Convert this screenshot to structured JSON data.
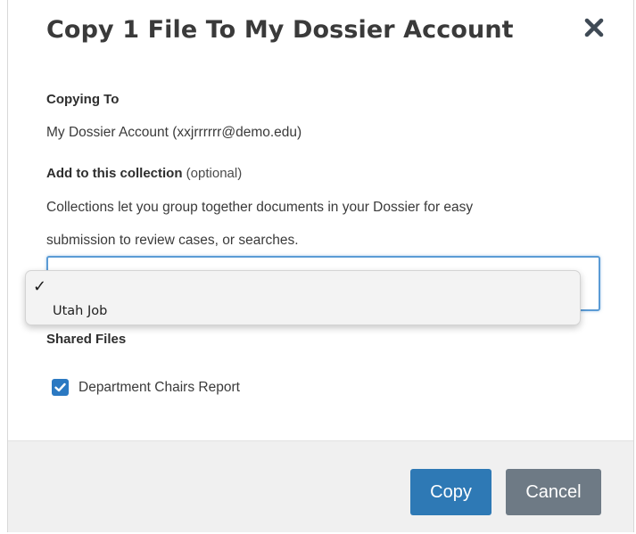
{
  "modal": {
    "title": "Copy 1 File To My Dossier Account",
    "close_icon": "close-x-icon"
  },
  "copying_to": {
    "label": "Copying To",
    "value": "My Dossier Account (xxjrrrrrr@demo.edu)"
  },
  "collection": {
    "label": "Add to this collection",
    "optional": "(optional)",
    "description_line1": "Collections let you group together documents in your Dossier for easy",
    "description_line2": "submission to review cases, or searches.",
    "dropdown": {
      "selected_marker": "✓",
      "options": [
        "Utah Job"
      ]
    }
  },
  "shared_files": {
    "label": "Shared Files",
    "items": [
      {
        "label": "Department Chairs Report",
        "checked": true
      }
    ]
  },
  "footer": {
    "copy_label": "Copy",
    "cancel_label": "Cancel"
  },
  "colors": {
    "primary": "#2e79b5",
    "secondary": "#6e7a85",
    "focus_ring": "#5b9bd5",
    "checkbox": "#2b79c2"
  }
}
